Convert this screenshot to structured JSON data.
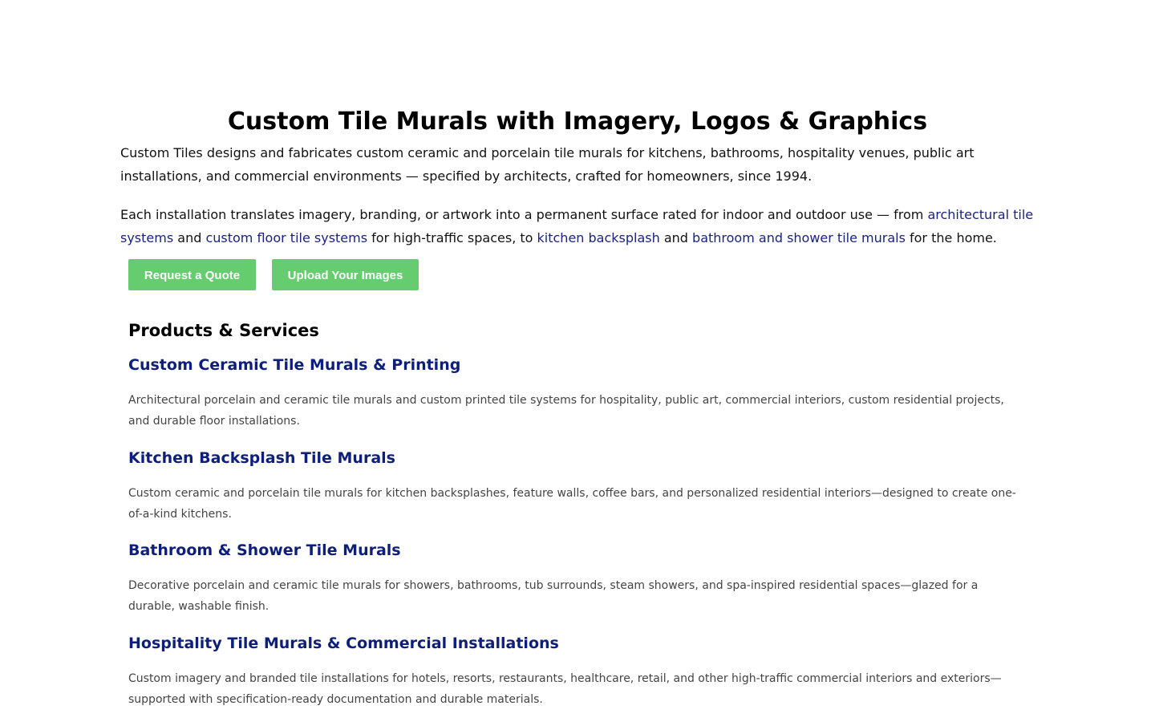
{
  "title": "Custom Tile Murals with Imagery, Logos & Graphics",
  "intro": "Custom Tiles designs and fabricates custom ceramic and porcelain tile murals for kitchens, bathrooms, hospitality venues, public art installations, and commercial environments — specified by architects, crafted for homeowners, since 1994.",
  "intro2": {
    "part1": "Each installation translates imagery, branding, or artwork into a permanent surface rated for indoor and outdoor use — from ",
    "link1": "architectural tile systems",
    "part2": " and ",
    "link2": "custom floor tile systems",
    "part3": " for high-traffic spaces, to ",
    "link3": "kitchen backsplash",
    "part4": " and ",
    "link4": "bathroom and shower tile murals",
    "part5": " for the home."
  },
  "buttons": {
    "quote": "Request a Quote",
    "upload": "Upload Your Images"
  },
  "section_title": "Products & Services",
  "services": [
    {
      "title": "Custom Ceramic Tile Murals & Printing",
      "description": "Architectural porcelain and ceramic tile murals and custom printed tile systems for hospitality, public art, commercial interiors, custom residential projects, and durable floor installations."
    },
    {
      "title": "Kitchen Backsplash Tile Murals",
      "description": "Custom ceramic and porcelain tile murals for kitchen backsplashes, feature walls, coffee bars, and personalized residential interiors—designed to create one-of-a-kind kitchens."
    },
    {
      "title": "Bathroom & Shower Tile Murals",
      "description": "Decorative porcelain and ceramic tile murals for showers, bathrooms, tub surrounds, steam showers, and spa-inspired residential spaces—glazed for a durable, washable finish."
    },
    {
      "title": "Hospitality Tile Murals & Commercial Installations",
      "description": "Custom imagery and branded tile installations for hotels, resorts, restaurants, healthcare, retail, and other high-traffic commercial interiors and exteriors—supported with specification-ready documentation and durable materials."
    }
  ],
  "colors": {
    "button": "#66cc70",
    "link": "#1a237e",
    "heading_link": "#0d1f7a"
  }
}
